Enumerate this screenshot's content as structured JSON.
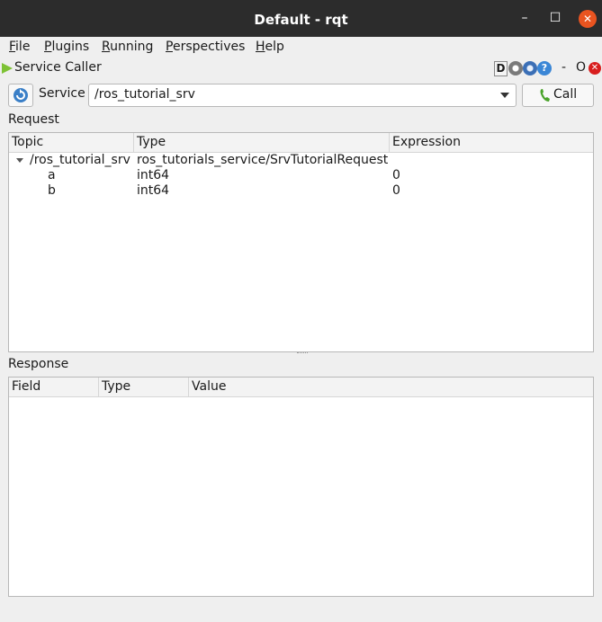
{
  "window": {
    "title": "Default - rqt",
    "minimize": "–",
    "maximize": "☐",
    "close": "✕"
  },
  "menubar": [
    {
      "mnemonic": "F",
      "rest": "ile"
    },
    {
      "mnemonic": "P",
      "rest": "lugins"
    },
    {
      "mnemonic": "R",
      "rest": "unning"
    },
    {
      "mnemonic": "P",
      "rest": "erspectives"
    },
    {
      "mnemonic": "H",
      "rest": "elp"
    }
  ],
  "plugin": {
    "name": "Service Caller",
    "d_label": "D",
    "help_label": "?",
    "dash_label": "-",
    "o_label": "O",
    "x_label": "✕"
  },
  "toolbar": {
    "service_label": "Service",
    "service_value": "/ros_tutorial_srv",
    "call_label": "Call"
  },
  "request": {
    "label": "Request",
    "columns": [
      "Topic",
      "Type",
      "Expression"
    ],
    "rows": [
      {
        "topic": "/ros_tutorial_srv",
        "type": "ros_tutorials_service/SrvTutorialRequest",
        "expression": ""
      },
      {
        "topic": "a",
        "type": "int64",
        "expression": "0"
      },
      {
        "topic": "b",
        "type": "int64",
        "expression": "0"
      }
    ]
  },
  "response": {
    "label": "Response",
    "columns": [
      "Field",
      "Type",
      "Value"
    ]
  },
  "colors": {
    "titlebar": "#2c2c2c",
    "close_button": "#e95420",
    "play_green": "#7ec235"
  }
}
